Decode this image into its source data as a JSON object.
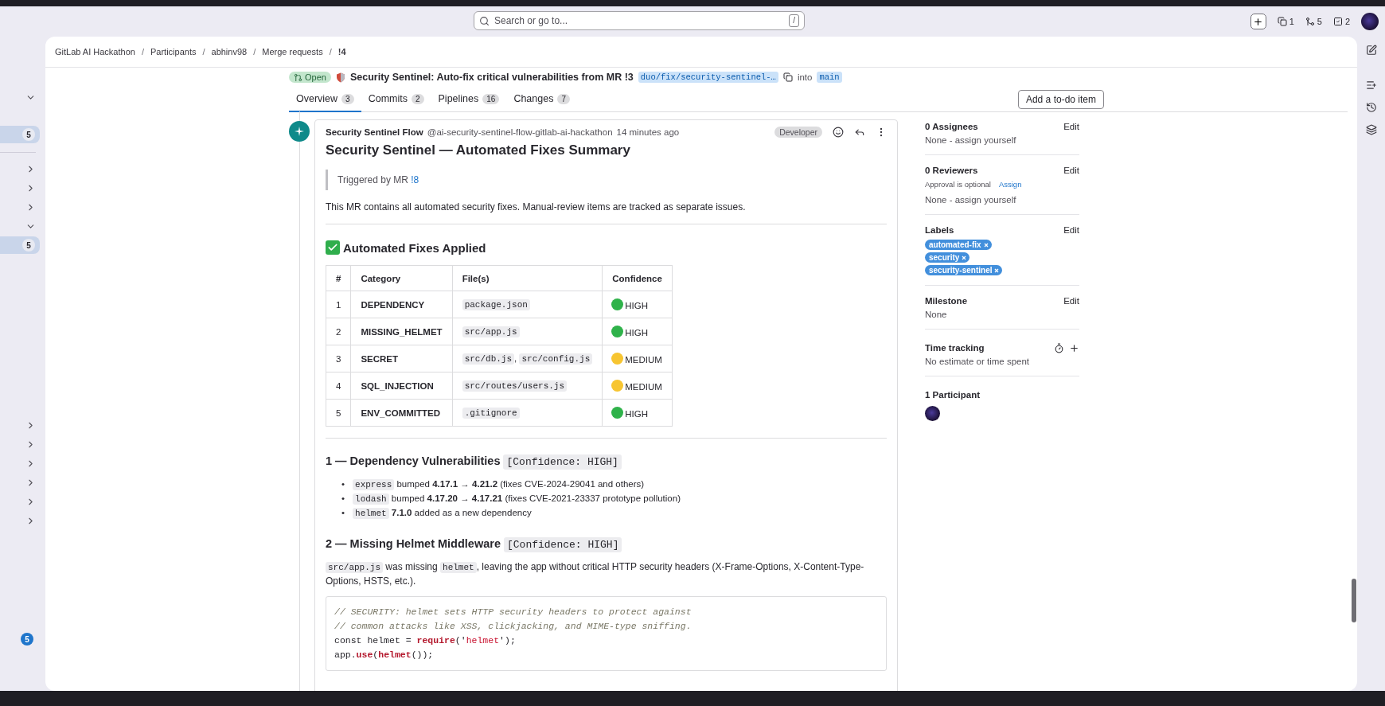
{
  "topbar": {
    "search": {
      "placeholder": "Search or go to...",
      "shortcut": "/"
    },
    "counters": [
      {
        "kind": "issues",
        "count": "1"
      },
      {
        "kind": "merge-requests",
        "count": "5"
      },
      {
        "kind": "todos",
        "count": "2"
      }
    ]
  },
  "sidebar": {
    "items": [
      {
        "kind": "toggle",
        "expanded": true
      },
      {
        "kind": "count",
        "count": "5",
        "selected": true
      },
      {
        "kind": "divider"
      },
      {
        "kind": "toggle",
        "expanded": false
      },
      {
        "kind": "toggle",
        "expanded": false
      },
      {
        "kind": "toggle",
        "expanded": false
      },
      {
        "kind": "toggle",
        "expanded": true
      },
      {
        "kind": "count",
        "count": "5",
        "selected": true
      },
      {
        "kind": "toggle",
        "expanded": false
      },
      {
        "kind": "toggle",
        "expanded": false
      },
      {
        "kind": "toggle",
        "expanded": false
      },
      {
        "kind": "toggle",
        "expanded": false
      },
      {
        "kind": "toggle",
        "expanded": false
      },
      {
        "kind": "toggle",
        "expanded": false
      },
      {
        "kind": "notice",
        "count": "5"
      }
    ]
  },
  "breadcrumbs": [
    {
      "label": "GitLab AI Hackathon"
    },
    {
      "separator": "/",
      "label": "Participants"
    },
    {
      "separator": "/",
      "label": "abhinv98"
    },
    {
      "separator": "/",
      "label": "Merge requests"
    },
    {
      "separator": "/",
      "label": "!4"
    }
  ],
  "merge_request": {
    "status": "Open",
    "title": "Security Sentinel: Auto-fix critical vulnerabilities from MR !3",
    "source_branch": "duo/fix/security-sentinel-…",
    "into": "into",
    "target_branch": "main"
  },
  "tabs": [
    {
      "label": "Overview",
      "count": "3",
      "selected": true
    },
    {
      "label": "Commits",
      "count": "2",
      "selected": false
    },
    {
      "label": "Pipelines",
      "count": "16",
      "selected": false
    },
    {
      "label": "Changes",
      "count": "7",
      "selected": false
    }
  ],
  "todo_button": "Add a to-do item",
  "comment": {
    "author": "Security Sentinel Flow",
    "handle": "@ai-security-sentinel-flow-gitlab-ai-hackathon",
    "time": "14 minutes ago",
    "role": "Developer",
    "heading": "Security Sentinel — Automated Fixes Summary",
    "quote": {
      "text": "Triggered by MR ",
      "link": "!8"
    },
    "intro": "This MR contains all automated security fixes. Manual-review items are tracked as separate issues.",
    "fixes_heading": "Automated Fixes Applied",
    "table": {
      "columns": [
        "#",
        "Category",
        "File(s)",
        "Confidence"
      ],
      "rows": [
        {
          "num": "1",
          "category": "DEPENDENCY",
          "files": [
            {
              "kind": "code",
              "text": "package.json"
            }
          ],
          "confidence": "HIGH",
          "color": "#2fb24a"
        },
        {
          "num": "2",
          "category": "MISSING_HELMET",
          "files": [
            {
              "kind": "code",
              "text": "src/app.js"
            }
          ],
          "confidence": "HIGH",
          "color": "#2fb24a"
        },
        {
          "num": "3",
          "category": "SECRET",
          "files": [
            {
              "kind": "code",
              "text": "src/db.js"
            },
            {
              "kind": "text",
              "text": ", "
            },
            {
              "kind": "code",
              "text": "src/config.js"
            }
          ],
          "confidence": "MEDIUM",
          "color": "#f7c531"
        },
        {
          "num": "4",
          "category": "SQL_INJECTION",
          "files": [
            {
              "kind": "code",
              "text": "src/routes/users.js"
            }
          ],
          "confidence": "MEDIUM",
          "color": "#f7c531"
        },
        {
          "num": "5",
          "category": "ENV_COMMITTED",
          "files": [
            {
              "kind": "code",
              "text": ".gitignore"
            }
          ],
          "confidence": "HIGH",
          "color": "#2fb24a"
        }
      ]
    },
    "sections": [
      {
        "title": "1 — Dependency Vulnerabilities",
        "tag": "[Confidence: HIGH]",
        "bullets": [
          {
            "marker": "•",
            "segments": [
              {
                "kind": "code",
                "text": "express"
              },
              {
                "kind": "text",
                "text": " bumped **4.17.1 → 4.21.2** (fixes CVE-2024-29041 and others)"
              }
            ]
          },
          {
            "marker": "•",
            "segments": [
              {
                "kind": "code",
                "text": "lodash"
              },
              {
                "kind": "text",
                "text": " bumped **4.17.20 → 4.17.21** (fixes CVE-2021-23337 prototype pollution)"
              }
            ]
          },
          {
            "marker": "•",
            "segments": [
              {
                "kind": "code",
                "text": "helmet"
              },
              {
                "kind": "text",
                "text": " **7.1.0** added as a new dependency"
              }
            ]
          }
        ]
      },
      {
        "title": "2 — Missing Helmet Middleware",
        "tag": "[Confidence: HIGH]",
        "paragraph": [
          {
            "kind": "code",
            "text": "src/app.js"
          },
          {
            "kind": "text",
            "text": " was missing "
          },
          {
            "kind": "code",
            "text": "helmet"
          },
          {
            "kind": "text",
            "text": ", leaving the app without critical HTTP security headers (X-Frame-Options, X-Content-Type-Options, HSTS, etc.)."
          }
        ],
        "code": [
          [
            {
              "kind": "comment",
              "text": "// SECURITY: helmet sets HTTP security headers to protect against"
            }
          ],
          [
            {
              "kind": "comment",
              "text": "// common attacks like XSS, clickjacking, and MIME-type sniffing."
            }
          ],
          [
            {
              "kind": "plain",
              "text": "const helmet = "
            },
            {
              "kind": "keyword",
              "text": "require"
            },
            {
              "kind": "plain",
              "text": "('"
            },
            {
              "kind": "string",
              "text": "helmet"
            },
            {
              "kind": "plain",
              "text": "');"
            }
          ],
          [
            {
              "kind": "plain",
              "text": "app."
            },
            {
              "kind": "keyword",
              "text": "use"
            },
            {
              "kind": "plain",
              "text": "("
            },
            {
              "kind": "keyword",
              "text": "helmet"
            },
            {
              "kind": "plain",
              "text": "());"
            }
          ]
        ]
      }
    ]
  },
  "details": {
    "assignees": {
      "title": "0 Assignees",
      "edit": "Edit",
      "value": "None - assign yourself"
    },
    "reviewers": {
      "title": "0 Reviewers",
      "edit": "Edit",
      "approval": "Approval is optional",
      "assign": "Assign",
      "value": "None - assign yourself"
    },
    "labels": {
      "title": "Labels",
      "edit": "Edit",
      "items": [
        {
          "text": "automated-fix",
          "color": "#428fdc"
        },
        {
          "text": "security",
          "color": "#428fdc"
        },
        {
          "text": "security-sentinel",
          "color": "#428fdc"
        }
      ]
    },
    "milestone": {
      "title": "Milestone",
      "edit": "Edit",
      "value": "None"
    },
    "time_tracking": {
      "title": "Time tracking",
      "value": "No estimate or time spent"
    },
    "participants": {
      "title": "1 Participant"
    }
  }
}
